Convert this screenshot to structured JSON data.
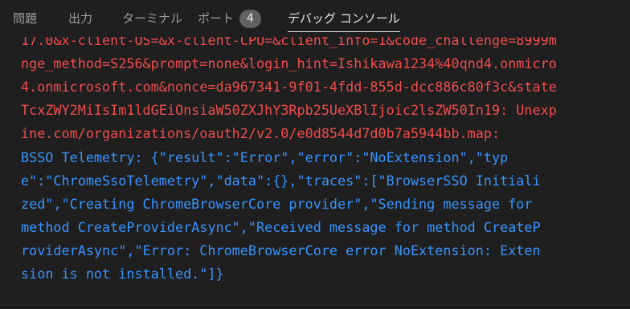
{
  "tabs": [
    {
      "label": "問題"
    },
    {
      "label": "出力"
    },
    {
      "label": "ターミナル"
    },
    {
      "label": "ポート",
      "badge": "4"
    },
    {
      "label": "デバッグ コンソール",
      "active": true
    }
  ],
  "console": {
    "lines": [
      {
        "type": "error",
        "text": "17.0&x-client-OS=&x-client-CPU=&client_info=1&code_challenge=8999m"
      },
      {
        "type": "error",
        "text": "nge_method=S256&prompt=none&login_hint=Ishikawa1234%40qnd4.onmicro"
      },
      {
        "type": "error",
        "text": "4.onmicrosoft.com&nonce=da967341-9f01-4fdd-855d-dcc886c80f3c&state"
      },
      {
        "type": "error",
        "text": "TcxZWY2MiIsIm1ldGEiOnsiaW50ZXJhY3Rpb25UeXBlIjoic2lsZW50In19: Unexp"
      },
      {
        "type": "error",
        "text": "ine.com/organizations/oauth2/v2.0/e0d8544d7d0b7a5944bb.map:"
      },
      {
        "type": "info",
        "text": "BSSO Telemetry: {\"result\":\"Error\",\"error\":\"NoExtension\",\"typ"
      },
      {
        "type": "info",
        "text": "e\":\"ChromeSsoTelemetry\",\"data\":{},\"traces\":[\"BrowserSSO Initiali"
      },
      {
        "type": "info",
        "text": "zed\",\"Creating ChromeBrowserCore provider\",\"Sending message for"
      },
      {
        "type": "info",
        "text": "method CreateProviderAsync\",\"Received message for method CreateP"
      },
      {
        "type": "info",
        "text": "roviderAsync\",\"Error: ChromeBrowserCore error NoExtension: Exten"
      },
      {
        "type": "info",
        "text": "sion is not installed.\"]}"
      }
    ]
  },
  "colors": {
    "background": "#1f1f1f",
    "error_text": "#f14c4c",
    "info_text": "#3794ff",
    "active_tab": "#e7e7e7",
    "inactive_tab": "#9d9d9d"
  }
}
